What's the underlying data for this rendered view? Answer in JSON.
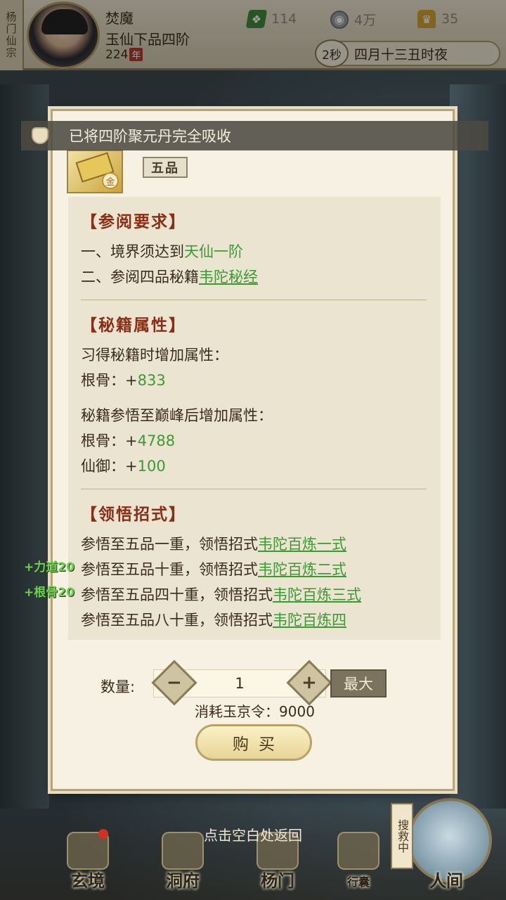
{
  "header": {
    "sect_tag": "杨门仙宗",
    "player_name": "焚魔",
    "realm": "玉仙下品四阶",
    "age_value": "224",
    "age_unit": "年",
    "resources": {
      "jade": "114",
      "coins": "4万",
      "gold": "35"
    },
    "timer": "2秒",
    "game_time": "四月十三丑时夜"
  },
  "toast": {
    "text": "已将四阶聚元丹完全吸收"
  },
  "item": {
    "grade": "五品",
    "badge": "金"
  },
  "requirements": {
    "title": "【参阅要求】",
    "line1_prefix": "一、境界须达到",
    "line1_value": "天仙一阶",
    "line2_prefix": "二、参阅四品秘籍",
    "line2_link": "韦陀秘经"
  },
  "attributes": {
    "title": "【秘籍属性】",
    "learn_heading": "习得秘籍时增加属性：",
    "learn_stats": [
      {
        "name": "根骨：+",
        "value": "833"
      }
    ],
    "peak_heading": "秘籍参悟至巅峰后增加属性：",
    "peak_stats": [
      {
        "name": "根骨：+",
        "value": "4788"
      },
      {
        "name": "仙御：+",
        "value": "100"
      }
    ]
  },
  "moves": {
    "title": "【领悟招式】",
    "items": [
      {
        "prefix": "参悟至五品一重，领悟招式",
        "link": "韦陀百炼一式"
      },
      {
        "prefix": "参悟至五品十重，领悟招式",
        "link": "韦陀百炼二式"
      },
      {
        "prefix": "参悟至五品四十重，领悟招式",
        "link": "韦陀百炼三式"
      },
      {
        "prefix": "参悟至五品八十重，领悟招式",
        "link": "韦陀百炼四"
      }
    ]
  },
  "purchase": {
    "qty_label": "数量:",
    "qty_value": "1",
    "max_label": "最大",
    "cost_text": "消耗玉京令：9000",
    "buy_label": "购买"
  },
  "buffs": [
    "+力道20",
    "+根骨20"
  ],
  "return_hint": "点击空白处返回",
  "nav": {
    "items": [
      "玄境",
      "洞府",
      "杨门",
      "行囊",
      "人间"
    ],
    "search_badge": "搜救中"
  },
  "colors": {
    "accent_green": "#3c9a34",
    "title_red": "#8a2e16",
    "panel_bg": "#f6f1e3"
  }
}
